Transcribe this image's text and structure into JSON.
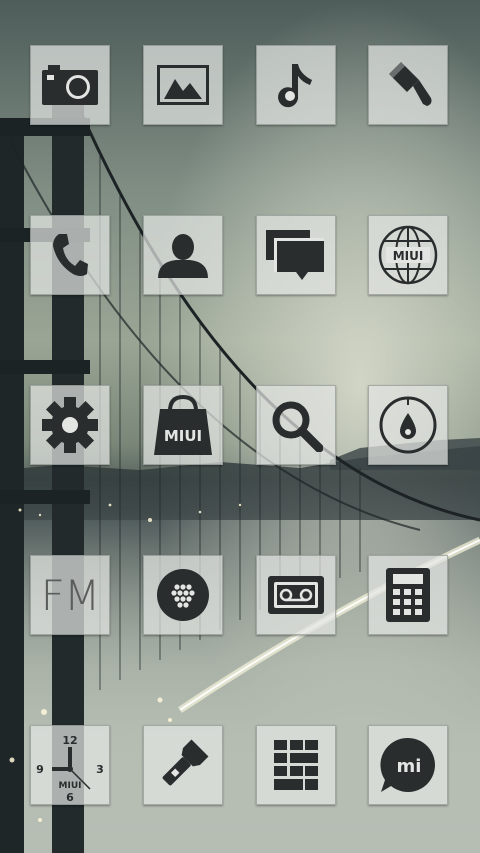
{
  "screen": {
    "wallpaper": "golden-gate-bridge-night",
    "rows": [
      [
        "camera-icon",
        "gallery-icon",
        "music-icon",
        "theme-brush-icon"
      ],
      [
        "phone-icon",
        "contacts-icon",
        "messages-icon",
        "browser-globe-icon"
      ],
      [
        "settings-gear-icon",
        "market-bag-icon",
        "search-icon",
        "compass-icon"
      ],
      [
        "fm-radio-icon",
        "cleaner-dots-icon",
        "voice-recorder-icon",
        "calculator-icon"
      ],
      [
        "clock-icon",
        "flashlight-icon",
        "file-manager-icon",
        "mi-talk-icon"
      ]
    ]
  },
  "labels": {
    "fm": "FM",
    "miui_globe": "MIUI",
    "miui_bag": "MIUI",
    "clock_brand": "MIUI",
    "clock_12": "12",
    "clock_3": "3",
    "clock_6": "6",
    "clock_9": "9",
    "mi_logo": "mi"
  },
  "colors": {
    "glyph": "#2a2d2e",
    "tile": "#e2e5e2"
  }
}
